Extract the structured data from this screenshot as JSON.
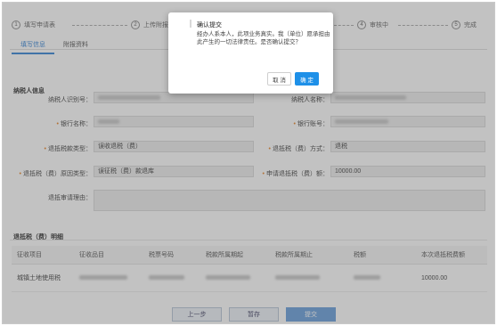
{
  "steps": [
    {
      "num": "1",
      "label": "填写申请表"
    },
    {
      "num": "2",
      "label": "上传附报资料"
    },
    {
      "num": "4",
      "label": "审核中"
    },
    {
      "num": "5",
      "label": "完成"
    }
  ],
  "tabs": [
    {
      "label": "填写信息",
      "active": true
    },
    {
      "label": "附报资料",
      "active": false
    }
  ],
  "taxpayer_section": "纳税人信息",
  "form": {
    "taxpayer_id_label": "纳税人识别号：",
    "taxpayer_name_label": "纳税人名称：",
    "bank_label": "银行名称：",
    "account_label": "银行账号：",
    "refund_type_label": "退抵税款类型：",
    "refund_type_value": "误收退税（费）",
    "refund_method_label": "退抵税（费）方式：",
    "refund_method_value": "退税",
    "reason_type_label": "退抵税（费）原因类型：",
    "reason_type_value": "误征税（费）款退库",
    "amount_label": "申请退抵税（费）额：",
    "amount_value": "10000.00",
    "reason_label": "退抵审请理由："
  },
  "table": {
    "title": "退抵税（费）明细",
    "headers": [
      "征收项目",
      "征收品目",
      "税票号码",
      "税款所属期起",
      "税款所属期止",
      "税额",
      "本次退抵税费额"
    ],
    "rows": [
      {
        "item": "城镇土地使用税",
        "amount": "10000.00"
      }
    ]
  },
  "buttons": {
    "prev": "上一步",
    "save": "暂存",
    "submit": "提交"
  },
  "modal": {
    "title": "确认提交",
    "body": "经办人系本人，此项业务真实。我（单位）愿承担由此产生的一切法律责任。是否确认提交？",
    "cancel": "取 消",
    "ok": "确 定"
  }
}
